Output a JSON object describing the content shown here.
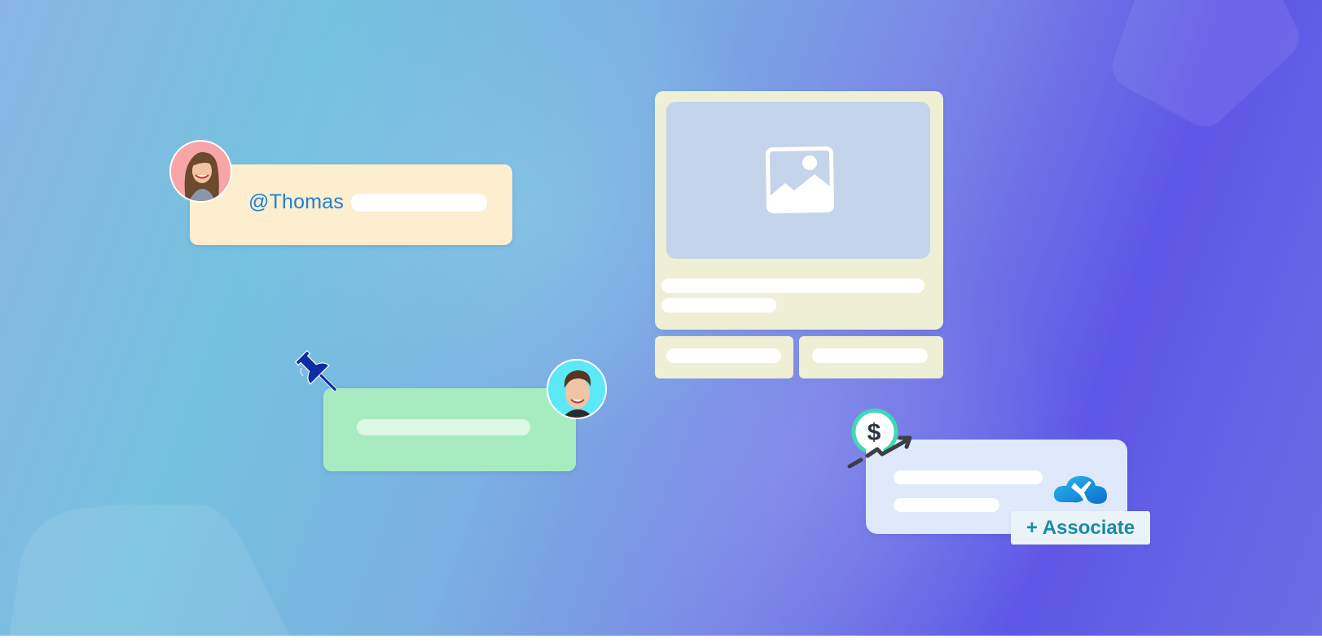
{
  "colors": {
    "mention_card": "#fdeed0",
    "mention_text": "#1f7fd4",
    "note_card": "#a7ecc1",
    "media_card": "#eeefd4",
    "media_image_area": "#c4d4ea",
    "associate_card": "#dfe9fb",
    "associate_text": "#1a8aa6",
    "pin": "#0b2ea3",
    "dollar_ring": "#3fd9b4",
    "cloud": "#1a96dc"
  },
  "mention_card": {
    "mention": "@Thomas",
    "avatar": "avatar-woman"
  },
  "note_card": {
    "avatar": "avatar-man",
    "pin_icon": "pushpin-icon"
  },
  "media_card": {
    "image_icon": "image-placeholder-icon"
  },
  "associate_card": {
    "badge_icon": "dollar-growth-icon",
    "app_icon": "cloud-plane-icon",
    "button_label": "+ Associate"
  }
}
